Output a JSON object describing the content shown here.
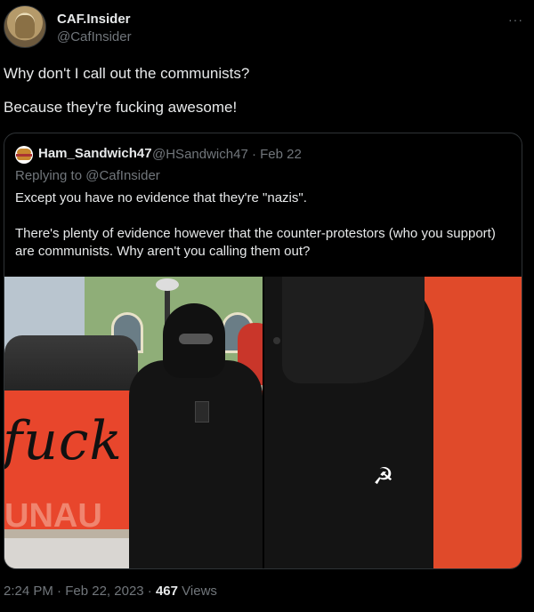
{
  "tweet": {
    "display_name": "CAF.Insider",
    "handle": "@CafInsider",
    "more_icon": "···",
    "lines": [
      "Why don't I call out the communists?",
      "Because they're fucking awesome!"
    ]
  },
  "quote": {
    "display_name": "Ham_Sandwich47",
    "handle": "@HSandwich47",
    "separator": "·",
    "date": "Feb 22",
    "replying_to": "Replying to @CafInsider",
    "paragraphs": [
      "Except you have no evidence that they're \"nazis\".",
      "There's plenty of evidence however that the counter-protestors (who you support) are communists. Why aren't you calling them out?"
    ],
    "media": {
      "left_banner_text": "fuck",
      "left_banner_text_lower": "UNAU",
      "right_symbol": "☭"
    }
  },
  "footer": {
    "time": "2:24 PM",
    "date": "Feb 22, 2023",
    "separator": "·",
    "views_count": "467",
    "views_label": "Views"
  }
}
